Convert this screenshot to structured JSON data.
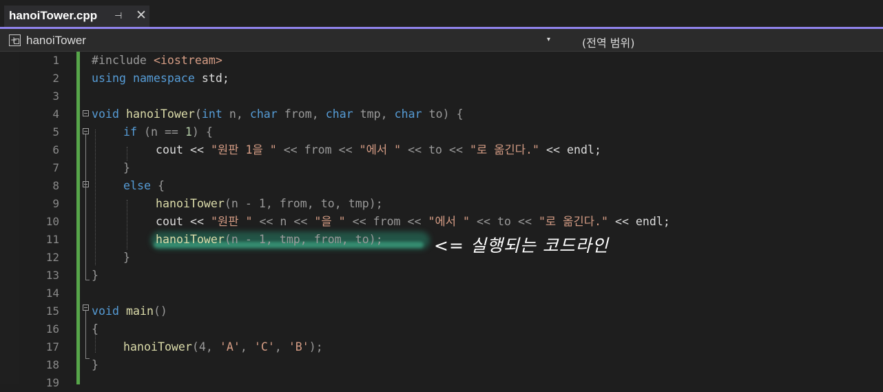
{
  "tab": {
    "title": "hanoiTower.cpp",
    "pin_glyph": "⊣",
    "close_glyph": "✕"
  },
  "navbar": {
    "class_icon": "class-icon",
    "class_name": "hanoiTower",
    "dropdown_glyph": "▾",
    "scope": "(전역 범위)"
  },
  "colors": {
    "accent": "#9184ee",
    "change_bar": "#57a64a",
    "keyword": "#569cd6",
    "function": "#dcdcaa",
    "string": "#d69d85"
  },
  "line_numbers": [
    "1",
    "2",
    "3",
    "4",
    "5",
    "6",
    "7",
    "8",
    "9",
    "10",
    "11",
    "12",
    "13",
    "14",
    "15",
    "16",
    "17",
    "18",
    "19"
  ],
  "code": {
    "l1": {
      "directive": "#include",
      "header": "<iostream>"
    },
    "l2": {
      "kw1": "using",
      "kw2": "namespace",
      "rest": "std;"
    },
    "l4": {
      "t0": "void",
      "f": "hanoiTower",
      "p0": "(",
      "t1": "int",
      "a1": " n, ",
      "t2": "char",
      "a2": " from, ",
      "t3": "char",
      "a3": " tmp, ",
      "t4": "char",
      "a4": " to) {"
    },
    "l5": {
      "kw": "if",
      "rest1": " (n == ",
      "num": "1",
      "rest2": ") {"
    },
    "l6": {
      "a": "cout << ",
      "s1": "\"원판 1을 \"",
      "b": " << from << ",
      "s2": "\"에서 \"",
      "c": " << to << ",
      "s3": "\"로 옮긴다.\"",
      "d": " << endl;"
    },
    "l7": {
      "text": "}"
    },
    "l8": {
      "kw": "else",
      "rest": " {"
    },
    "l9": {
      "f": "hanoiTower",
      "rest": "(n - 1, from, to, tmp);"
    },
    "l10": {
      "a": "cout << ",
      "s1": "\"원판 \"",
      "b": " << n << ",
      "s2": "\"을 \"",
      "c": " << from << ",
      "s3": "\"에서 \"",
      "d": " << to << ",
      "s4": "\"로 옮긴다.\"",
      "e": " << endl;"
    },
    "l11": {
      "f": "hanoiTower",
      "rest": "(n - 1, tmp, from, to);"
    },
    "l12": {
      "text": "}"
    },
    "l13": {
      "text": "}"
    },
    "l15": {
      "t": "void",
      "f": "main",
      "rest": "()"
    },
    "l16": {
      "text": "{"
    },
    "l17": {
      "f": "hanoiTower",
      "a": "(4, ",
      "s1": "'A'",
      "b": ", ",
      "s2": "'C'",
      "c": ", ",
      "s3": "'B'",
      "d": ");"
    },
    "l18": {
      "text": "}"
    }
  },
  "annotation": "<= 실행되는 코드라인"
}
